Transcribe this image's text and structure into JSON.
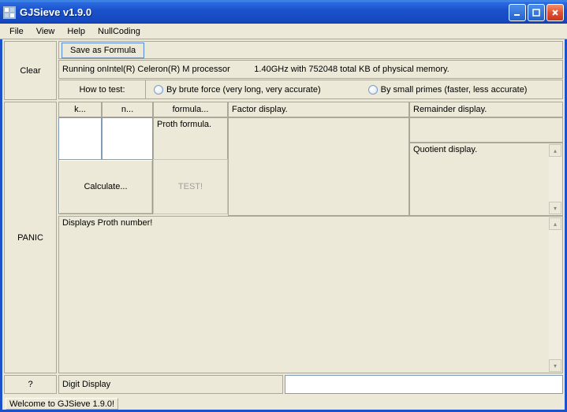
{
  "window": {
    "title": "GJSieve v1.9.0"
  },
  "menu": {
    "file": "File",
    "view": "View",
    "help": "Help",
    "nullcoding": "NullCoding"
  },
  "buttons": {
    "clear": "Clear",
    "save_formula": "Save as Formula",
    "calculate": "Calculate...",
    "test": "TEST!",
    "panic": "PANIC",
    "help": "?"
  },
  "info_text": "Running onIntel(R) Celeron(R) M processor          1.40GHz with 752048 total KB of physical memory.",
  "howto": {
    "label": "How to test:",
    "brute": "By brute force (very long, very accurate)",
    "primes": "By small primes (faster, less accurate)"
  },
  "headers": {
    "k": "k...",
    "n": "n...",
    "formula": "formula...",
    "factor": "Factor display.",
    "remainder": "Remainder display.",
    "quotient": "Quotient display."
  },
  "proth_formula": "Proth formula.",
  "big_text": "Displays Proth number!",
  "digit_label": "Digit Display",
  "status": "Welcome to GJSieve 1.9.0!"
}
